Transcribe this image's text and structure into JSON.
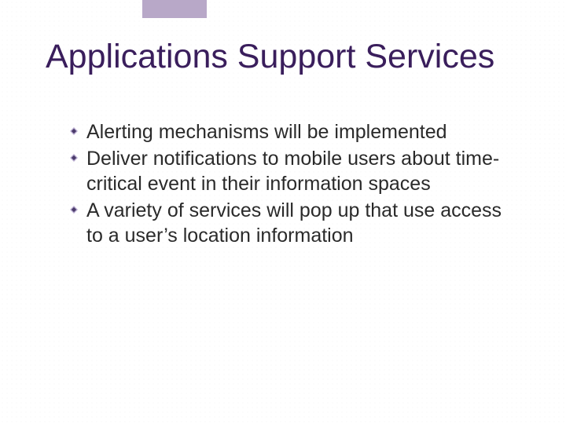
{
  "slide": {
    "title": "Applications Support Services",
    "bullets": [
      "Alerting mechanisms will be implemented",
      "Deliver notifications to mobile users about time-critical event in their information spaces",
      "A variety of services will pop up that use access to a user’s location information"
    ]
  },
  "colors": {
    "title": "#3a1e5c",
    "accent_bar": "#b8a8c8",
    "bullet_dark": "#4a3a6a",
    "bullet_light": "#b9acd0"
  }
}
